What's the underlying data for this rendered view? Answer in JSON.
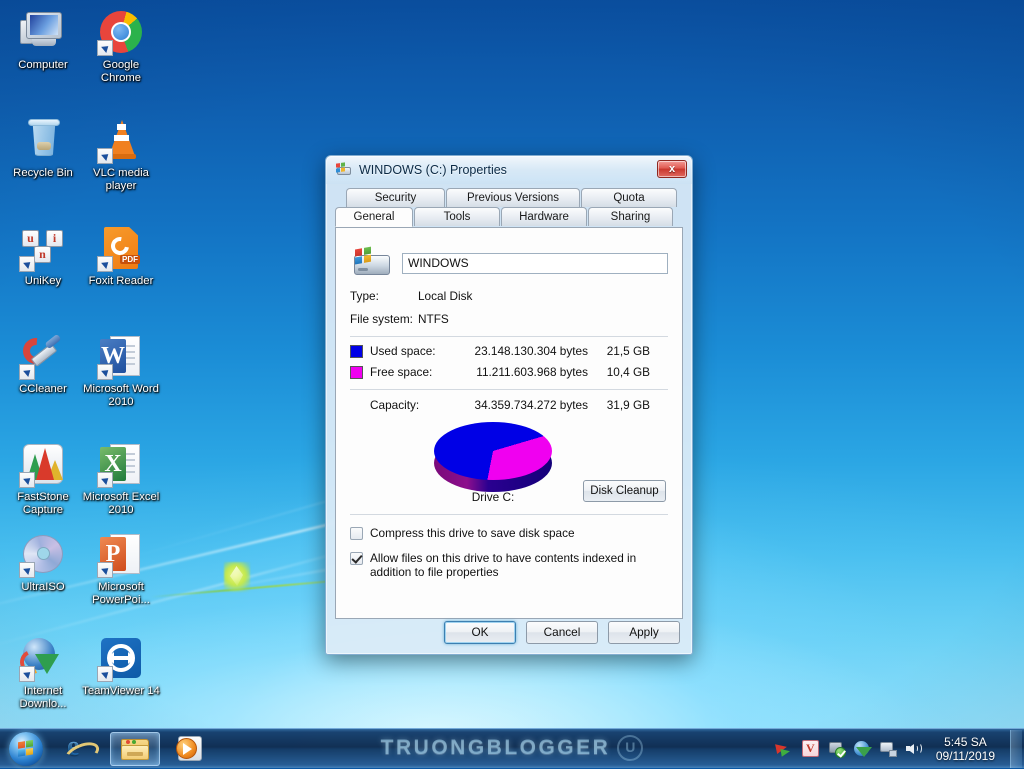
{
  "desktop": {
    "icons": [
      {
        "label": "Computer",
        "icon": "computer-icon"
      },
      {
        "label": "Google Chrome",
        "icon": "chrome-icon"
      },
      {
        "label": "Recycle Bin",
        "icon": "recycle-bin-icon"
      },
      {
        "label": "VLC media player",
        "icon": "vlc-icon"
      },
      {
        "label": "UniKey",
        "icon": "unikey-icon"
      },
      {
        "label": "Foxit Reader",
        "icon": "foxit-reader-icon"
      },
      {
        "label": "CCleaner",
        "icon": "ccleaner-icon"
      },
      {
        "label": "Microsoft Word 2010",
        "icon": "word-icon"
      },
      {
        "label": "FastStone Capture",
        "icon": "faststone-capture-icon"
      },
      {
        "label": "Microsoft Excel 2010",
        "icon": "excel-icon"
      },
      {
        "label": "UltraISO",
        "icon": "ultraiso-icon"
      },
      {
        "label": "Microsoft PowerPoi...",
        "icon": "powerpoint-icon"
      },
      {
        "label": "Internet Downlo...",
        "icon": "idm-icon"
      },
      {
        "label": "TeamViewer 14",
        "icon": "teamviewer-icon"
      }
    ]
  },
  "dialog": {
    "title": "WINDOWS (C:) Properties",
    "close_label": "x",
    "tabs_row1": [
      "Security",
      "Previous Versions",
      "Quota"
    ],
    "tabs_row2": [
      "General",
      "Tools",
      "Hardware",
      "Sharing"
    ],
    "active_tab": "General",
    "volume_name": "WINDOWS",
    "type_label": "Type:",
    "type_value": "Local Disk",
    "fs_label": "File system:",
    "fs_value": "NTFS",
    "used_label": "Used space:",
    "used_bytes": "23.148.130.304 bytes",
    "used_gb": "21,5 GB",
    "free_label": "Free space:",
    "free_bytes": "11.211.603.968 bytes",
    "free_gb": "10,4 GB",
    "capacity_label": "Capacity:",
    "capacity_bytes": "34.359.734.272 bytes",
    "capacity_gb": "31,9 GB",
    "drive_label": "Drive C:",
    "disk_cleanup_label": "Disk Cleanup",
    "compress_label": "Compress this drive to save disk space",
    "index_label": "Allow files on this drive to have contents indexed in addition to file properties",
    "ok_label": "OK",
    "cancel_label": "Cancel",
    "apply_label": "Apply",
    "used_color": "#0000e6",
    "free_color": "#f000f0"
  },
  "chart_data": {
    "type": "pie",
    "title": "Drive C:",
    "categories": [
      "Used space",
      "Free space"
    ],
    "values": [
      21.5,
      10.4
    ],
    "units": "GB",
    "colors": [
      "#0000e6",
      "#f000f0"
    ],
    "legend": "left",
    "labels": [
      "23.148.130.304 bytes",
      "11.211.603.968 bytes"
    ]
  },
  "taskbar": {
    "start_label": "Start",
    "buttons": [
      {
        "name": "internet-explorer",
        "label": "Internet Explorer"
      },
      {
        "name": "windows-explorer",
        "label": "Windows Explorer"
      },
      {
        "name": "windows-media-player",
        "label": "Windows Media Player"
      }
    ],
    "watermark": "TRUONGBLOGGER",
    "tray": [
      {
        "name": "nvidia-icon"
      },
      {
        "name": "antivirus-icon"
      },
      {
        "name": "windows-update-icon"
      },
      {
        "name": "network-globe-icon"
      },
      {
        "name": "lan-icon"
      },
      {
        "name": "volume-icon"
      }
    ],
    "clock_time": "5:45 SA",
    "clock_date": "09/11/2019"
  }
}
